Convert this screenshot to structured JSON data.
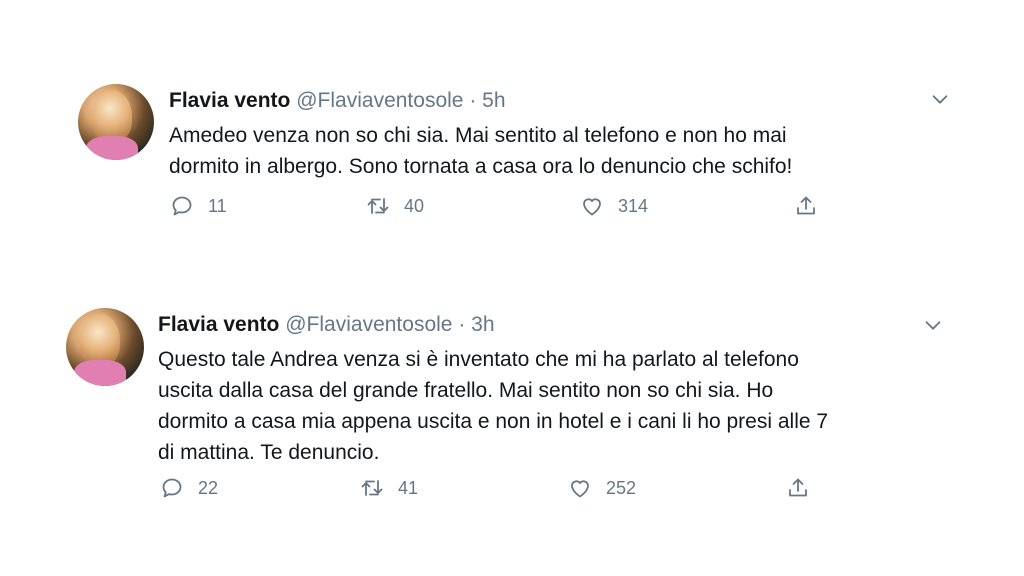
{
  "tweets": [
    {
      "name": "Flavia vento",
      "handle": "@Flaviaventosole",
      "separator": "·",
      "time": "5h",
      "text_lines": [
        "Amedeo venza non so chi sia. Mai sentito al telefono e non ho mai",
        "dormito in albergo. Sono tornata a casa ora lo denuncio che schifo!"
      ],
      "replies": "11",
      "retweets": "40",
      "likes": "314"
    },
    {
      "name": "Flavia vento",
      "handle": "@Flaviaventosole",
      "separator": "·",
      "time": "3h",
      "text_lines": [
        "Questo tale Andrea venza si è inventato che mi ha parlato al telefono",
        "uscita dalla casa del grande fratello. Mai sentito non so chi sia. Ho",
        "dormito a casa mia appena uscita e non in hotel e i cani li ho presi alle 7",
        "di mattina. Te denuncio."
      ],
      "replies": "22",
      "retweets": "41",
      "likes": "252"
    }
  ],
  "icons": {
    "reply": "reply-icon",
    "retweet": "retweet-icon",
    "like": "heart-icon",
    "share": "share-icon",
    "menu": "chevron-down-icon"
  },
  "colors": {
    "text": "#14171a",
    "secondary": "#657786",
    "avatar_shirt": "#e17fb3"
  }
}
